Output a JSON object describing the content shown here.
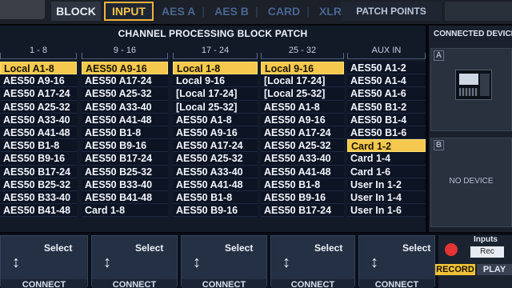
{
  "tabs": {
    "block": "BLOCK",
    "input": "INPUT",
    "sub": [
      "AES A",
      "AES B",
      "CARD",
      "XLR"
    ],
    "patch_points": "PATCH POINTS"
  },
  "panel": {
    "title": "CHANNEL PROCESSING BLOCK PATCH",
    "columns": [
      {
        "header": "1 - 8",
        "cells": [
          "Local A1-8",
          "AES50 A9-16",
          "AES50 A17-24",
          "AES50 A25-32",
          "AES50 A33-40",
          "AES50 A41-48",
          "AES50 B1-8",
          "AES50 B9-16",
          "AES50 B17-24",
          "AES50 B25-32",
          "AES50 B33-40",
          "AES50 B41-48"
        ],
        "selected": 0
      },
      {
        "header": "9 - 16",
        "cells": [
          "AES50 A9-16",
          "AES50 A17-24",
          "AES50 A25-32",
          "AES50 A33-40",
          "AES50 A41-48",
          "AES50 B1-8",
          "AES50 B9-16",
          "AES50 B17-24",
          "AES50 B25-32",
          "AES50 B33-40",
          "AES50 B41-48",
          "Card 1-8"
        ],
        "selected": 0
      },
      {
        "header": "17 - 24",
        "cells": [
          "Local 1-8",
          "Local 9-16",
          "[Local 17-24]",
          "[Local 25-32]",
          "AES50 A1-8",
          "AES50 A9-16",
          "AES50 A17-24",
          "AES50 A25-32",
          "AES50 A33-40",
          "AES50 A41-48",
          "AES50 B1-8",
          "AES50 B9-16"
        ],
        "selected": 0
      },
      {
        "header": "25 - 32",
        "cells": [
          "Local 9-16",
          "[Local 17-24]",
          "[Local 25-32]",
          "AES50 A1-8",
          "AES50 A9-16",
          "AES50 A17-24",
          "AES50 A25-32",
          "AES50 A33-40",
          "AES50 A41-48",
          "AES50 B1-8",
          "AES50 B9-16",
          "AES50 B17-24"
        ],
        "selected": 0
      },
      {
        "header": "AUX IN",
        "cells": [
          "AES50 A1-2",
          "AES50 A1-4",
          "AES50 A1-6",
          "AES50 B1-2",
          "AES50 B1-4",
          "AES50 B1-6",
          "Card 1-2",
          "Card 1-4",
          "Card 1-6",
          "User In 1-2",
          "User In 1-4",
          "User In 1-6"
        ],
        "selected": 6
      }
    ]
  },
  "right_panel": {
    "title": "CONNECTED DEVICES",
    "slot_a": "A",
    "slot_b": "B",
    "no_device": "NO DEVICE"
  },
  "controls": {
    "select_label": "Select",
    "connect_label": "CONNECT",
    "inputs_label": "Inputs",
    "rec_field": "Rec",
    "record": "RECORD",
    "play": "PLAY"
  },
  "colors": {
    "selected": "#f5c94d",
    "record_dot": "#e23434",
    "accent": "#f0b23a"
  }
}
